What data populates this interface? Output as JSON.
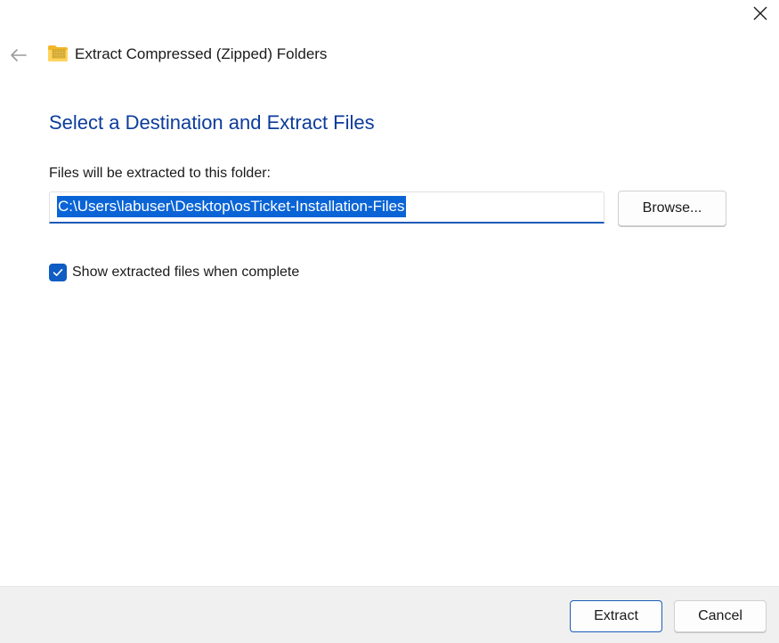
{
  "window": {
    "title": "Extract Compressed (Zipped) Folders",
    "close_icon": "close-icon",
    "back_icon": "back-arrow-icon",
    "title_icon": "zipped-folder-icon"
  },
  "main": {
    "heading": "Select a Destination and Extract Files",
    "destination_label": "Files will be extracted to this folder:",
    "destination_path": "C:\\Users\\labuser\\Desktop\\osTicket-Installation-Files",
    "destination_selected": true,
    "browse_label": "Browse...",
    "show_files_checkbox": {
      "label": "Show extracted files when complete",
      "checked": true
    }
  },
  "footer": {
    "extract_label": "Extract",
    "cancel_label": "Cancel"
  },
  "colors": {
    "heading": "#0c3c9b",
    "accent": "#0f5cc4",
    "selection": "#0a64d6",
    "footer_bg": "#f0f0f0"
  }
}
